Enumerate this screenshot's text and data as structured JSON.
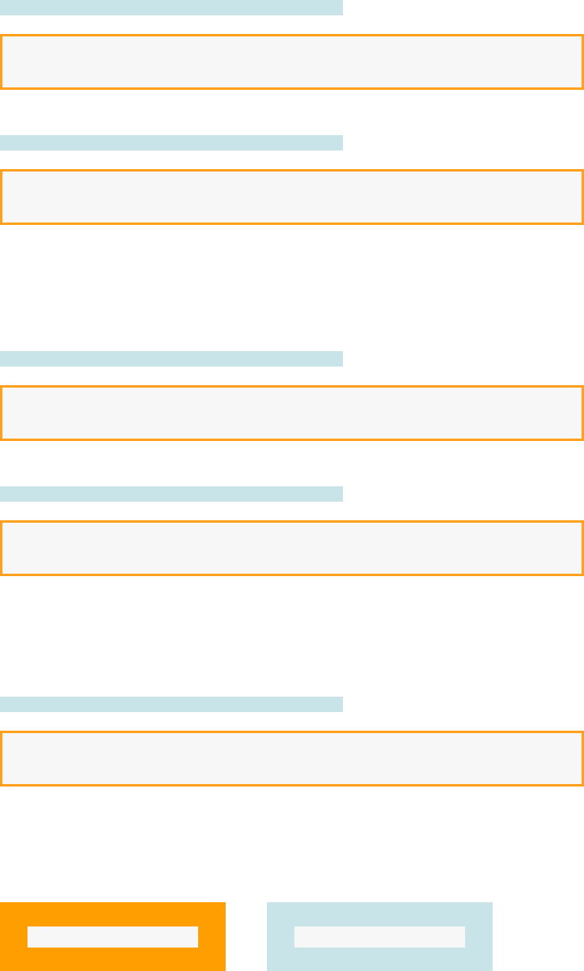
{
  "form": {
    "groups": [
      {
        "fields": [
          {
            "kind": "text"
          },
          {
            "kind": "text"
          }
        ]
      },
      {
        "fields": [
          {
            "kind": "text"
          },
          {
            "kind": "text"
          }
        ]
      },
      {
        "fields": [
          {
            "kind": "text"
          }
        ]
      }
    ]
  },
  "buttons": [
    {
      "kind": "primary"
    },
    {
      "kind": "secondary"
    }
  ]
}
